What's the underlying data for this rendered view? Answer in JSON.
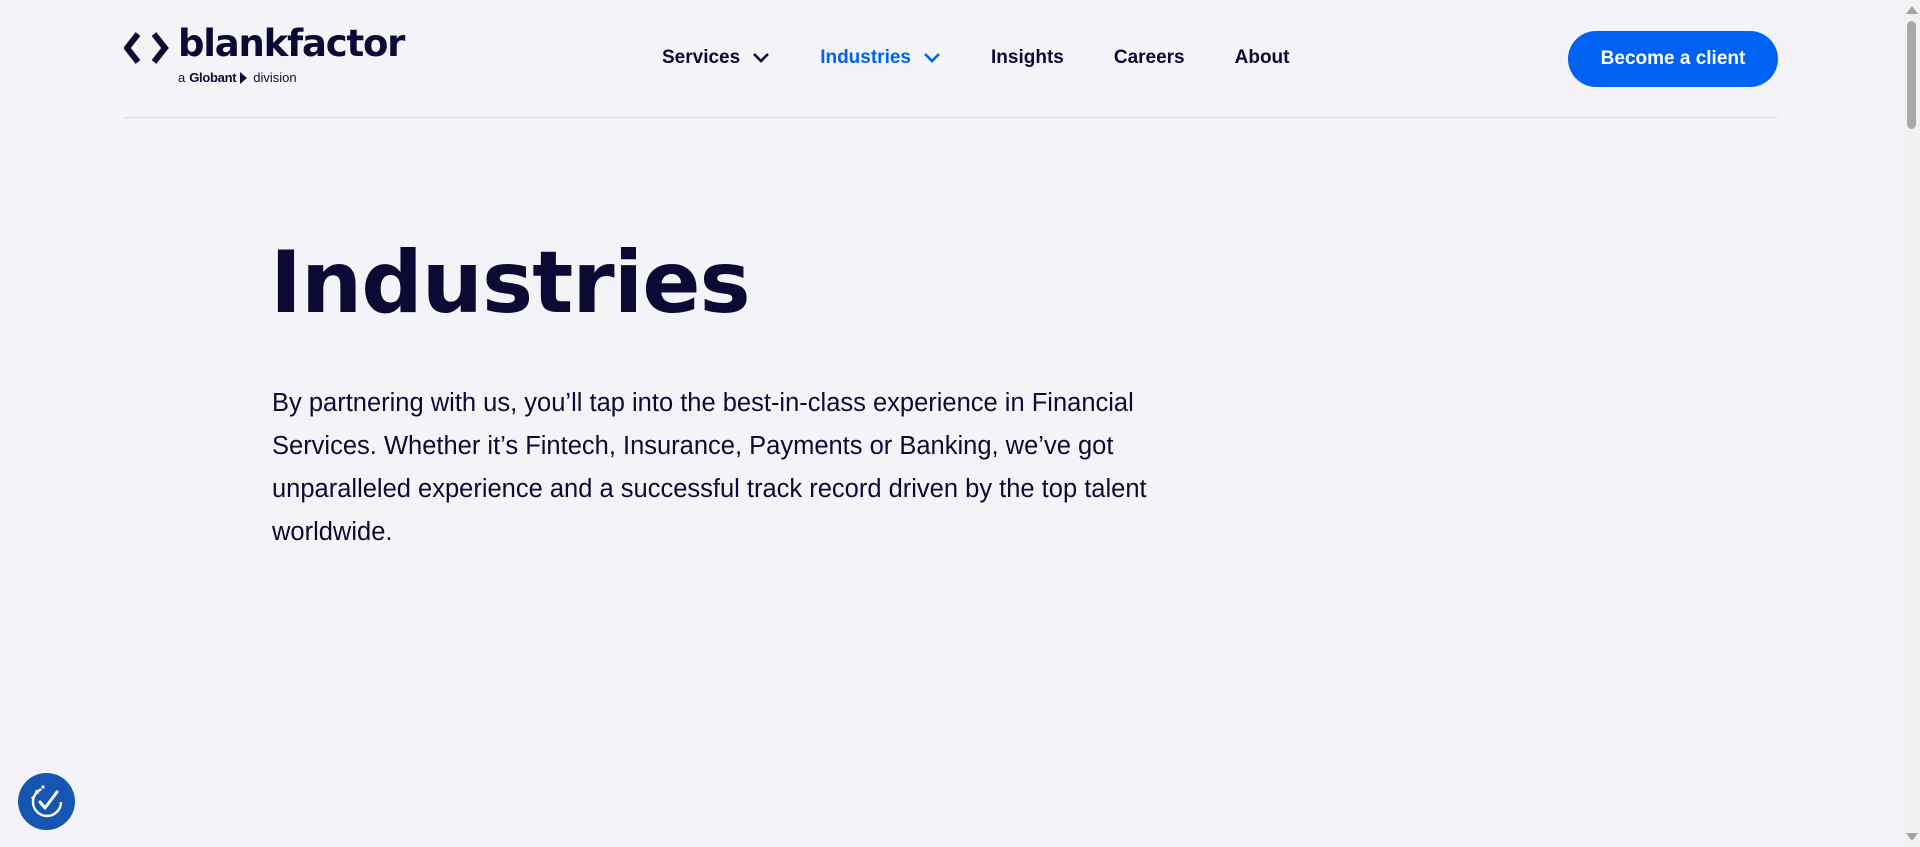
{
  "header": {
    "logo": {
      "wordmark": "blankfactor",
      "tagline_prefix": "a",
      "tagline_brand": "Globant",
      "tagline_suffix": "division"
    },
    "nav": [
      {
        "label": "Services",
        "has_dropdown": true,
        "active": false
      },
      {
        "label": "Industries",
        "has_dropdown": true,
        "active": true
      },
      {
        "label": "Insights",
        "has_dropdown": false,
        "active": false
      },
      {
        "label": "Careers",
        "has_dropdown": false,
        "active": false
      },
      {
        "label": "About",
        "has_dropdown": false,
        "active": false
      }
    ],
    "cta_label": "Become a client"
  },
  "hero": {
    "title": "Industries",
    "description": "By partnering with us, you’ll tap into the best-in-class experience in Financial Services. Whether it’s Fintech, Insurance, Payments or Banking, we’ve got unparalleled experience and a successful track record driven by the top talent worldwide."
  },
  "accessibility_widget": {
    "icon": "accessibility-check-icon"
  },
  "colors": {
    "brand_navy": "#0b0a35",
    "accent_blue": "#0062f5",
    "background": "#f4f4f8",
    "badge_blue": "#1656b2"
  }
}
